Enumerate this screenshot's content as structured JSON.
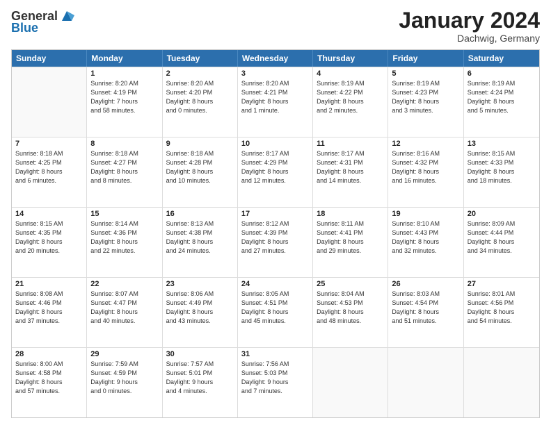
{
  "logo": {
    "general": "General",
    "blue": "Blue"
  },
  "title": "January 2024",
  "location": "Dachwig, Germany",
  "days_header": [
    "Sunday",
    "Monday",
    "Tuesday",
    "Wednesday",
    "Thursday",
    "Friday",
    "Saturday"
  ],
  "weeks": [
    [
      {
        "day": "",
        "info": ""
      },
      {
        "day": "1",
        "info": "Sunrise: 8:20 AM\nSunset: 4:19 PM\nDaylight: 7 hours\nand 58 minutes."
      },
      {
        "day": "2",
        "info": "Sunrise: 8:20 AM\nSunset: 4:20 PM\nDaylight: 8 hours\nand 0 minutes."
      },
      {
        "day": "3",
        "info": "Sunrise: 8:20 AM\nSunset: 4:21 PM\nDaylight: 8 hours\nand 1 minute."
      },
      {
        "day": "4",
        "info": "Sunrise: 8:19 AM\nSunset: 4:22 PM\nDaylight: 8 hours\nand 2 minutes."
      },
      {
        "day": "5",
        "info": "Sunrise: 8:19 AM\nSunset: 4:23 PM\nDaylight: 8 hours\nand 3 minutes."
      },
      {
        "day": "6",
        "info": "Sunrise: 8:19 AM\nSunset: 4:24 PM\nDaylight: 8 hours\nand 5 minutes."
      }
    ],
    [
      {
        "day": "7",
        "info": "Sunrise: 8:18 AM\nSunset: 4:25 PM\nDaylight: 8 hours\nand 6 minutes."
      },
      {
        "day": "8",
        "info": "Sunrise: 8:18 AM\nSunset: 4:27 PM\nDaylight: 8 hours\nand 8 minutes."
      },
      {
        "day": "9",
        "info": "Sunrise: 8:18 AM\nSunset: 4:28 PM\nDaylight: 8 hours\nand 10 minutes."
      },
      {
        "day": "10",
        "info": "Sunrise: 8:17 AM\nSunset: 4:29 PM\nDaylight: 8 hours\nand 12 minutes."
      },
      {
        "day": "11",
        "info": "Sunrise: 8:17 AM\nSunset: 4:31 PM\nDaylight: 8 hours\nand 14 minutes."
      },
      {
        "day": "12",
        "info": "Sunrise: 8:16 AM\nSunset: 4:32 PM\nDaylight: 8 hours\nand 16 minutes."
      },
      {
        "day": "13",
        "info": "Sunrise: 8:15 AM\nSunset: 4:33 PM\nDaylight: 8 hours\nand 18 minutes."
      }
    ],
    [
      {
        "day": "14",
        "info": "Sunrise: 8:15 AM\nSunset: 4:35 PM\nDaylight: 8 hours\nand 20 minutes."
      },
      {
        "day": "15",
        "info": "Sunrise: 8:14 AM\nSunset: 4:36 PM\nDaylight: 8 hours\nand 22 minutes."
      },
      {
        "day": "16",
        "info": "Sunrise: 8:13 AM\nSunset: 4:38 PM\nDaylight: 8 hours\nand 24 minutes."
      },
      {
        "day": "17",
        "info": "Sunrise: 8:12 AM\nSunset: 4:39 PM\nDaylight: 8 hours\nand 27 minutes."
      },
      {
        "day": "18",
        "info": "Sunrise: 8:11 AM\nSunset: 4:41 PM\nDaylight: 8 hours\nand 29 minutes."
      },
      {
        "day": "19",
        "info": "Sunrise: 8:10 AM\nSunset: 4:43 PM\nDaylight: 8 hours\nand 32 minutes."
      },
      {
        "day": "20",
        "info": "Sunrise: 8:09 AM\nSunset: 4:44 PM\nDaylight: 8 hours\nand 34 minutes."
      }
    ],
    [
      {
        "day": "21",
        "info": "Sunrise: 8:08 AM\nSunset: 4:46 PM\nDaylight: 8 hours\nand 37 minutes."
      },
      {
        "day": "22",
        "info": "Sunrise: 8:07 AM\nSunset: 4:47 PM\nDaylight: 8 hours\nand 40 minutes."
      },
      {
        "day": "23",
        "info": "Sunrise: 8:06 AM\nSunset: 4:49 PM\nDaylight: 8 hours\nand 43 minutes."
      },
      {
        "day": "24",
        "info": "Sunrise: 8:05 AM\nSunset: 4:51 PM\nDaylight: 8 hours\nand 45 minutes."
      },
      {
        "day": "25",
        "info": "Sunrise: 8:04 AM\nSunset: 4:53 PM\nDaylight: 8 hours\nand 48 minutes."
      },
      {
        "day": "26",
        "info": "Sunrise: 8:03 AM\nSunset: 4:54 PM\nDaylight: 8 hours\nand 51 minutes."
      },
      {
        "day": "27",
        "info": "Sunrise: 8:01 AM\nSunset: 4:56 PM\nDaylight: 8 hours\nand 54 minutes."
      }
    ],
    [
      {
        "day": "28",
        "info": "Sunrise: 8:00 AM\nSunset: 4:58 PM\nDaylight: 8 hours\nand 57 minutes."
      },
      {
        "day": "29",
        "info": "Sunrise: 7:59 AM\nSunset: 4:59 PM\nDaylight: 9 hours\nand 0 minutes."
      },
      {
        "day": "30",
        "info": "Sunrise: 7:57 AM\nSunset: 5:01 PM\nDaylight: 9 hours\nand 4 minutes."
      },
      {
        "day": "31",
        "info": "Sunrise: 7:56 AM\nSunset: 5:03 PM\nDaylight: 9 hours\nand 7 minutes."
      },
      {
        "day": "",
        "info": ""
      },
      {
        "day": "",
        "info": ""
      },
      {
        "day": "",
        "info": ""
      }
    ]
  ]
}
